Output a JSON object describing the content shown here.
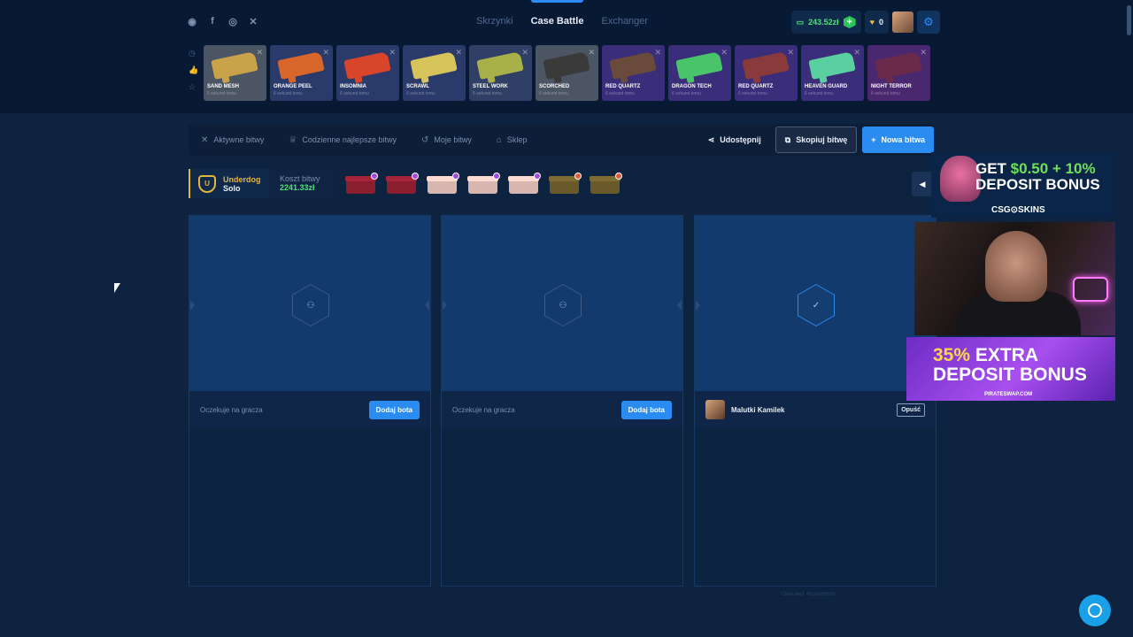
{
  "header": {
    "nav": [
      {
        "label": "Skrzynki",
        "active": false
      },
      {
        "label": "Case Battle",
        "active": true
      },
      {
        "label": "Exchanger",
        "active": false
      }
    ],
    "balance": "243.52zł",
    "gems": "0",
    "social_icons": [
      "discord-icon",
      "facebook-icon",
      "instagram-icon",
      "x-icon"
    ]
  },
  "live_drops": [
    {
      "name": "SAND MESH",
      "sub": "6 sekund temu",
      "color": "#4b5563",
      "gun": "#c9a24a"
    },
    {
      "name": "ORANGE PEEL",
      "sub": "6 sekund temu",
      "color": "#2a3a6a",
      "gun": "#d8652a"
    },
    {
      "name": "INSOMNIA",
      "sub": "6 sekund temu",
      "color": "#2a3a6a",
      "gun": "#d8452a"
    },
    {
      "name": "SCRAWL",
      "sub": "6 sekund temu",
      "color": "#2a3a6a",
      "gun": "#d6c45a"
    },
    {
      "name": "STEEL WORK",
      "sub": "6 sekund temu",
      "color": "#2f3f66",
      "gun": "#a8b04a"
    },
    {
      "name": "SCORCHED",
      "sub": "6 sekund temu",
      "color": "#4b5563",
      "gun": "#3a3a3a"
    },
    {
      "name": "RED QUARTZ",
      "sub": "6 sekund temu",
      "color": "#3a2d7a",
      "gun": "#6a4a3a"
    },
    {
      "name": "DRAGON TECH",
      "sub": "6 sekund temu",
      "color": "#3a2d7a",
      "gun": "#4ac46a"
    },
    {
      "name": "RED QUARTZ",
      "sub": "6 sekund temu",
      "color": "#3a2d7a",
      "gun": "#8a3a3a"
    },
    {
      "name": "HEAVEN GUARD",
      "sub": "6 sekund temu",
      "color": "#3a2d7a",
      "gun": "#5ad0a0"
    },
    {
      "name": "NIGHT TERROR",
      "sub": "6 sekund temu",
      "color": "#4a2870",
      "gun": "#6a2a4a"
    }
  ],
  "tabs": [
    {
      "label": "Aktywne bitwy",
      "icon": "swords-icon"
    },
    {
      "label": "Codzienne najlepsze bitwy",
      "icon": "trophy-icon"
    },
    {
      "label": "Moje bitwy",
      "icon": "history-icon"
    },
    {
      "label": "Sklep",
      "icon": "basket-icon"
    }
  ],
  "actions": {
    "share": "Udostępnij",
    "copy": "Skopiuj bitwę",
    "new": "Nowa bitwa"
  },
  "battle": {
    "mode_label": "Underdog",
    "mode_value": "Solo",
    "cost_label": "Koszt bitwy",
    "cost_value": "2241.33zł",
    "cases": [
      {
        "box": "#8a1e2e",
        "badge": "#a04ae0"
      },
      {
        "box": "#8a1e2e",
        "badge": "#a04ae0"
      },
      {
        "box": "#d8b6b0",
        "badge": "#a04ae0"
      },
      {
        "box": "#d8b6b0",
        "badge": "#a04ae0"
      },
      {
        "box": "#d8b6b0",
        "badge": "#a04ae0"
      },
      {
        "box": "#6a5a2a",
        "badge": "#e05a3a"
      },
      {
        "box": "#6a5a2a",
        "badge": "#e05a3a"
      }
    ]
  },
  "slots": [
    {
      "status": "Oczekuje na gracza",
      "button": "Dodaj bota"
    },
    {
      "status": "Oczekuje na gracza",
      "button": "Dodaj bota"
    },
    {
      "player": "Malutki Kamilek",
      "button": "Opuść"
    }
  ],
  "client_seed": "Client seed: 4/Qzhu/Bbh59",
  "ads": {
    "top_headline_a": "GET ",
    "top_headline_b": "$0.50 + 10%",
    "top_headline_c": "DEPOSIT BONUS",
    "top_brand": "CSG⊙SKINS",
    "bottom_headline_a": "35%",
    "bottom_headline_b": " EXTRA",
    "bottom_headline_c": "DEPOSIT BONUS",
    "bottom_site": "PIRATESWAP.COM"
  }
}
